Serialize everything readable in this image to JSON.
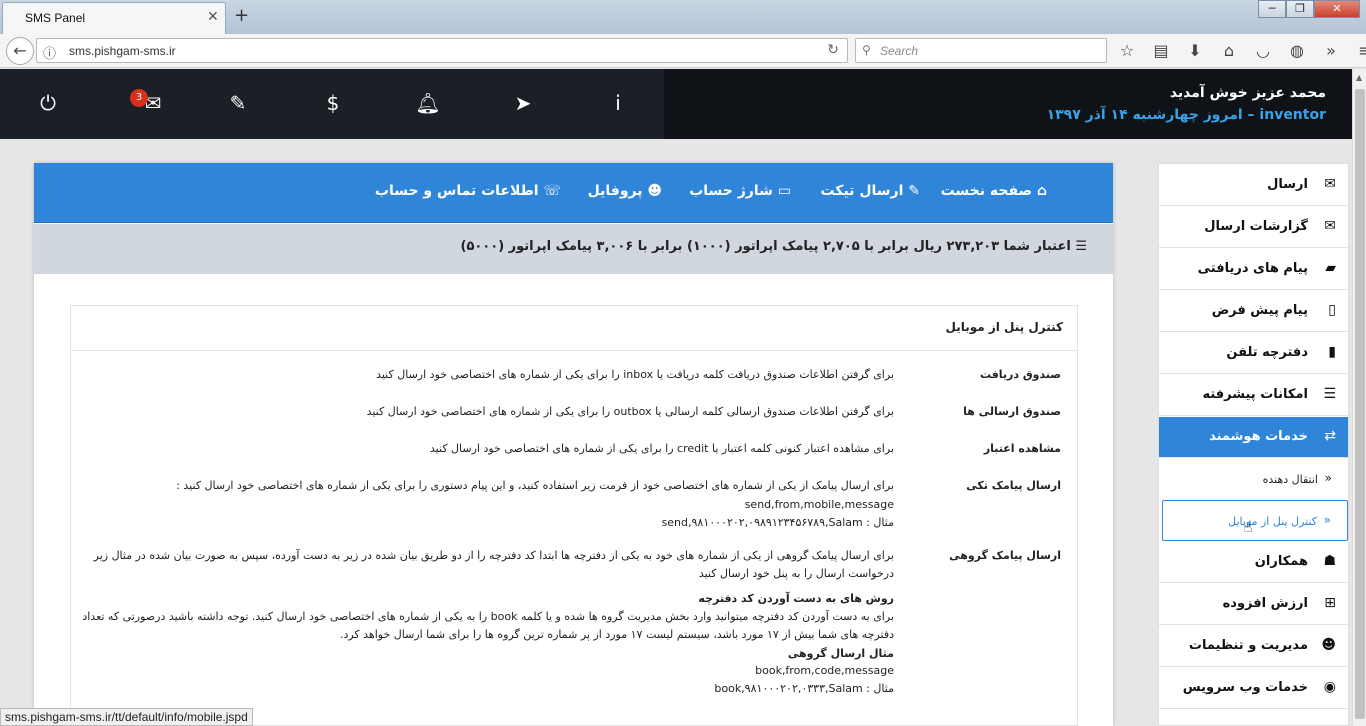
{
  "browser": {
    "tab_title": "SMS Panel",
    "tab_close": "✕",
    "new_tab": "+",
    "url": "sms.pishgam-sms.ir",
    "search_placeholder": "Search",
    "status_url": "sms.pishgam-sms.ir/tt/default/info/mobile.jspd"
  },
  "header": {
    "welcome": "محمد عزیز خوش آمدید",
    "username": "inventor",
    "date": "امروز چهارشنبه ۱۴ آذر ۱۳۹۷",
    "message_badge": "3",
    "icons": [
      "power-icon",
      "mail-icon",
      "ticket-icon",
      "dollar-icon",
      "bell-icon",
      "send-icon",
      "info-icon"
    ]
  },
  "topnav": {
    "home": "صفحه نخست",
    "ticket": "ارسال تیکت",
    "charge": "شارژ حساب",
    "profile": "پروفایل",
    "contact": "اطلاعات تماس و حساب"
  },
  "credit": "اعتبار شما ۲۷۳,۲۰۳ ریال برابر با ۲,۷۰۵ پیامک اپراتور (۱۰۰۰) برابر با ۳,۰۰۶ پیامک اپراتور (۵۰۰۰)",
  "card": {
    "title": "کنترل پنل از موبایل",
    "rows": [
      {
        "label": "صندوق دریافت",
        "text": "برای گرفتن اطلاعات صندوق دریافت کلمه دریافت یا inbox را برای یکی از شماره های اختصاصی خود ارسال کنید"
      },
      {
        "label": "صندوق ارسالی ها",
        "text": "برای گرفتن اطلاعات صندوق ارسالی کلمه ارسالی یا outbox را برای یکی از شماره های اختصاصی خود ارسال کنید"
      },
      {
        "label": "مشاهده اعتبار",
        "text": "برای مشاهده اعتبار کنونی کلمه اعتبار یا credit را برای یکی از شماره های اختصاصی خود ارسال کنید"
      },
      {
        "label": "ارسال پیامک تکی",
        "text": "برای ارسال پیامک از یکی از شماره های اختصاصی خود از فرمت زیر استفاده کنید، و این پیام دستوری را برای یکی از شماره های اختصاصی خود ارسال کنید :",
        "format": "send,from,mobile,message",
        "example": "مثال : send,۹۸۱۰۰۰۲۰۲,۰۹۸۹۱۲۳۴۵۶۷۸۹,Salam"
      },
      {
        "label": "ارسال پیامک گروهی",
        "text1": "برای ارسال پیامک گروهی از یکی از شماره های خود به یکی از دفترچه ها ابتدا کد دفترچه را از دو طریق بیان شده در زیر به دست آورده، سپس به صورت بیان شده در مثال زیر",
        "text2": "درخواست ارسال را به پنل خود ارسال کنید",
        "sub_title": "روش های به دست آوردن کد دفترچه",
        "sub1": "برای به دست آوردن کد دفترچه میتوانید وارد بخش مدیریت گروه ها شده و یا کلمه book را به یکی از شماره های اختصاصی خود ارسال کنید. توجه داشته باشید درصورتی که تعداد",
        "sub2": "دفترچه های شما بیش از ۱۷ مورد باشد، سیستم لیست ۱۷ مورد از پر شماره ترین گروه ها را برای شما ارسال خواهد کرد.",
        "example_title": "مثال ارسال گروهی",
        "format": "book,from,code,message",
        "example": "مثال : book,۹۸۱۰۰۰۲۰۲,۰۳۳۳,Salam"
      }
    ]
  },
  "sidebar": {
    "items": [
      {
        "label": "ارسال",
        "icon": "✉"
      },
      {
        "label": "گزارشات ارسال",
        "icon": "✉"
      },
      {
        "label": "پیام های دریافتی",
        "icon": "▰"
      },
      {
        "label": "پیام پیش فرض",
        "icon": "▯"
      },
      {
        "label": "دفترچه تلفن",
        "icon": "▮"
      },
      {
        "label": "امکانات پیشرفته",
        "icon": "☰"
      },
      {
        "label": "خدمات هوشمند",
        "icon": "⇄"
      },
      {
        "label": "همکاران",
        "icon": "☗"
      },
      {
        "label": "ارزش افزوده",
        "icon": "⊞"
      },
      {
        "label": "مدیریت و تنظیمات",
        "icon": "☻"
      },
      {
        "label": "خدمات وب سرویس",
        "icon": "◉"
      }
    ],
    "sub_items": [
      {
        "label": "انتقال دهنده",
        "arrow": "»"
      },
      {
        "label": "کنترل پنل از موبایل",
        "arrow": "»"
      }
    ]
  }
}
